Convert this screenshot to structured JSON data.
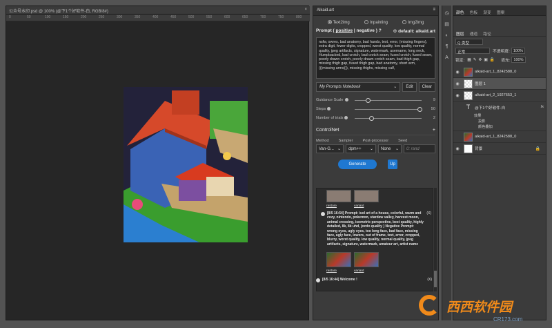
{
  "document": {
    "tab_title": "公众号水印.psd @ 100% (@下1个好软件-白, RGB/8#)",
    "close_glyph": "×",
    "ruler_marks": [
      "0",
      "50",
      "100",
      "150",
      "200",
      "250",
      "300",
      "350",
      "400",
      "450",
      "500",
      "550",
      "600",
      "650",
      "700",
      "750",
      "800"
    ]
  },
  "plugin": {
    "tab_label": "Alkaid.art",
    "menu_glyph": "≡",
    "modes": [
      {
        "label": "Text2img",
        "selected": true
      },
      {
        "label": "Inpainting",
        "selected": false
      },
      {
        "label": "Img2img",
        "selected": false
      }
    ],
    "prompt_header": {
      "pre": "Prompt (",
      "positive": "positive",
      "mid": "| negative )",
      "help": "?",
      "default_label": "⚙ default: alkaid.art"
    },
    "prompt_text": "nsfw, owres, bad anatomy, bad hands, text, error, (missing fingers), extra digit, fewer digits, cropped, worst quality, low quality, normal quality, jpeg artifacts, signature, watermark, username, long neck, Humpbacked, bad crotch, bad crotch seam, fused crotch, fused seam, poorly drawn crotch, poorly drawn crotch seam, bad thigh gap, missing thigh gap, fused thigh gap, bad anatomy, short arm, (((missing arms))), missing thighs, missing calf,",
    "notebook": {
      "label": "My Prompts Notebook",
      "edit": "Edit",
      "clear": "Clear"
    },
    "sliders": [
      {
        "label": "Guidance Scale",
        "value": "9",
        "position": 0.2
      },
      {
        "label": "Steps",
        "value": "50",
        "position": 0.97
      },
      {
        "label": "Number of trials",
        "value": "2",
        "position": 0.25
      }
    ],
    "controlnet": {
      "title": "ControlNet",
      "plus": "+",
      "labels": [
        "Method",
        "Sampler",
        "Post-processor",
        "Seed"
      ],
      "method": "Van-G...",
      "sampler": "dpm++",
      "post": "None",
      "seed_placeholder": "0: rand"
    },
    "generate_label": "Generate",
    "up_label": "Up",
    "history": {
      "restore": "restore",
      "variant": "variant",
      "entry_text": "[8/5 16:54] Prompt: isol art of a house, colorful, warm and cozy, nintendo, pokemon, stardew valley, harvest moon, animal crossing, isometric perspective, best quality, highly detailed, 8k, 8k uhd, (ocdo quality ) Negative Prompt: wrong eyes, ugly eyes, too long face, bad face, missing face, ugly face, lowers, out of frame, text, error, cropped, blurry, worst quality, low quality, normal quality, jpeg artifacts, signature, watermark, amateur art, artist name",
      "close": "(X)",
      "welcome": "[8/5 16:44] Welcome !"
    }
  },
  "layers_panel": {
    "tabs_top": [
      "颜色",
      "色板",
      "渐变",
      "图案"
    ],
    "tabs_mid": [
      "图层",
      "通道",
      "路径"
    ],
    "kind_label": "Q 类型",
    "blend_mode": "正常",
    "opacity_label": "不透明度:",
    "opacity_value": "100%",
    "lock_label": "锁定:",
    "fill_label": "填充:",
    "fill_value": "100%",
    "layers": [
      {
        "name": "alkaid-art_1_8242588_0",
        "thumb": "img",
        "selected": false
      },
      {
        "name": "图层 1",
        "thumb": "checker",
        "selected": true
      },
      {
        "name": "alkaid-art_2_1927653_1",
        "thumb": "checker",
        "selected": false
      },
      {
        "name": "@下1个好软件-白",
        "thumb": "txt",
        "selected": false,
        "fx": "fx"
      },
      {
        "name": "alkaid-art_1_8242588_0",
        "thumb": "img",
        "selected": false
      },
      {
        "name": "背景",
        "thumb": "white",
        "selected": false
      }
    ],
    "effects": [
      "效果",
      "投影",
      "颜色叠加"
    ]
  },
  "watermark": {
    "text": "西西软件园",
    "url": "CR173.com"
  }
}
